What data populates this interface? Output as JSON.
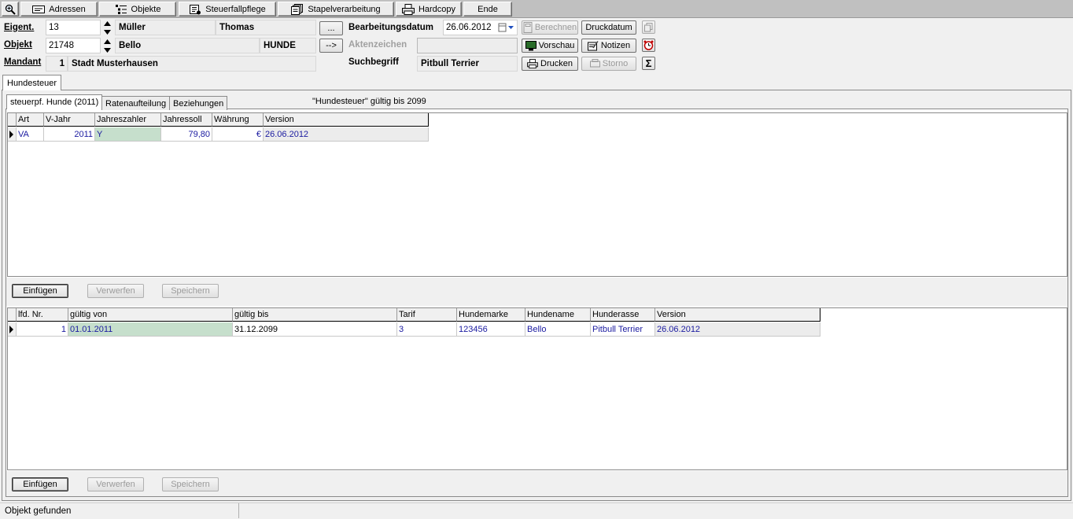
{
  "toolbar": {
    "buttons": [
      {
        "label": "Adressen",
        "icon": "address-card-icon"
      },
      {
        "label": "Objekte",
        "icon": "objects-list-icon"
      },
      {
        "label": "Steuerfallpflege",
        "icon": "tax-case-icon"
      },
      {
        "label": "Stapelverarbeitung",
        "icon": "batch-stack-icon"
      },
      {
        "label": "Hardcopy",
        "icon": "printer-icon"
      },
      {
        "label": "Ende",
        "icon": ""
      }
    ]
  },
  "header": {
    "eigent_label": "Eigent.",
    "eigent_value": "13",
    "eigent_name": "Müller",
    "eigent_firstname": "Thomas",
    "objekt_label": "Objekt",
    "objekt_value": "21748",
    "objekt_name": "Bello",
    "objekt_type": "HUNDE",
    "mandant_label": "Mandant",
    "mandant_value": "1",
    "mandant_name": "Stadt Musterhausen",
    "ellipsis_button": "...",
    "arrow_button": "-->",
    "bearbeitungsdatum_label": "Bearbeitungsdatum",
    "bearbeitungsdatum_value": "26.06.2012",
    "aktenzeichen_label": "Aktenzeichen",
    "aktenzeichen_value": "",
    "suchbegriff_label": "Suchbegriff",
    "suchbegriff_value": "Pitbull Terrier",
    "berechnen": "Berechnen",
    "druckdatum": "Druckdatum",
    "vorschau": "Vorschau",
    "notizen": "Notizen",
    "drucken": "Drucken",
    "storno": "Storno"
  },
  "main_tab": "Hundesteuer",
  "sub_tabs": [
    "steuerpf. Hunde (2011)",
    "Ratenaufteilung",
    "Beziehungen"
  ],
  "validity_note": "\"Hundesteuer\" gültig bis 2099",
  "grid1": {
    "columns": [
      "Art",
      "V-Jahr",
      "Jahreszahler",
      "Jahressoll",
      "Währung",
      "Version"
    ],
    "rows": [
      [
        "VA",
        "2011",
        "Y",
        "79,80",
        "€",
        "26.06.2012"
      ]
    ]
  },
  "grid2": {
    "columns": [
      "lfd. Nr.",
      "gültig von",
      "gültig bis",
      "Tarif",
      "Hundemarke",
      "Hundename",
      "Hunderasse",
      "Version"
    ],
    "rows": [
      [
        "1",
        "01.01.2011",
        "31.12.2099",
        "3",
        "123456",
        "Bello",
        "Pitbull Terrier",
        "26.06.2012"
      ]
    ]
  },
  "actions": {
    "insert": "Einfügen",
    "discard": "Verwerfen",
    "save": "Speichern"
  },
  "status": "Objekt gefunden"
}
